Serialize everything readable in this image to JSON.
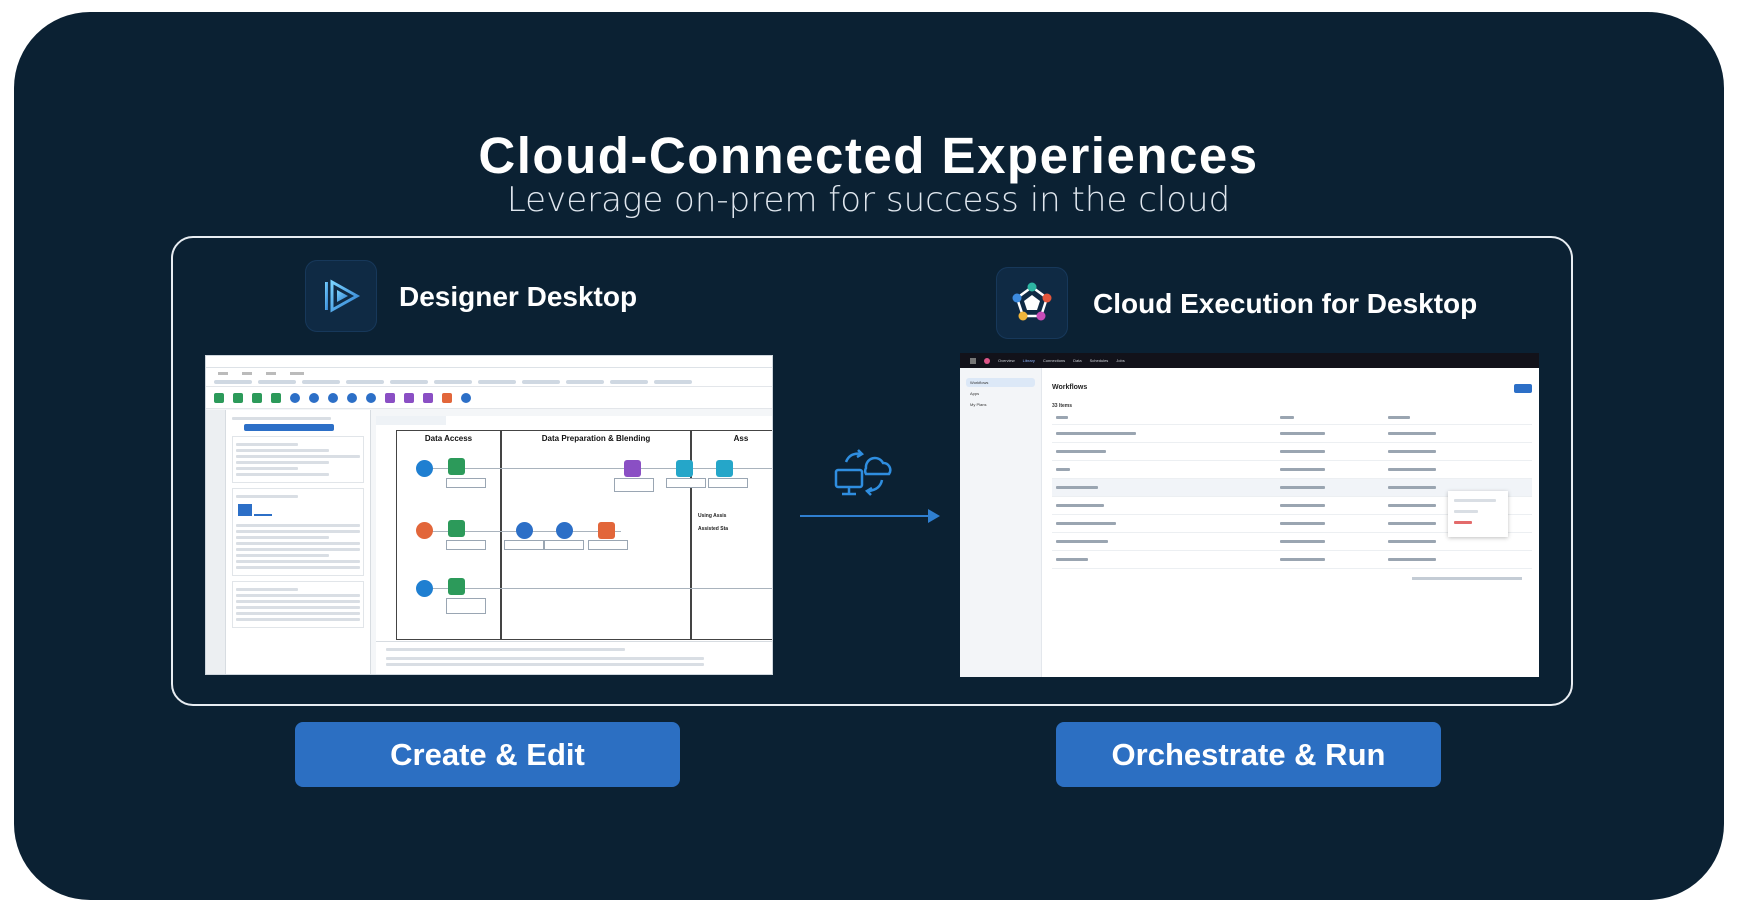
{
  "header": {
    "title": "Cloud-Connected Experiences",
    "subtitle": "Leverage on-prem for success in the cloud"
  },
  "left_panel": {
    "title": "Designer Desktop",
    "logo_icon": "designer-play-icon",
    "screenshot": {
      "containers": [
        "Data Access",
        "Data Preparation & Blending",
        "Ass"
      ],
      "canvas_labels": [
        "Using Assis",
        "Assisted Sta"
      ]
    },
    "button_label": "Create & Edit"
  },
  "right_panel": {
    "title": "Cloud Execution for Desktop",
    "logo_icon": "pentagon-nodes-icon",
    "screenshot": {
      "nav": [
        "Overview",
        "Library",
        "Connections",
        "Data",
        "Schedules",
        "Jobs"
      ],
      "sidebar": [
        "Workflows",
        "Apps",
        "My Plans"
      ],
      "heading": "Workflows",
      "count": "33 Items"
    },
    "button_label": "Orchestrate & Run"
  },
  "connector": {
    "icon": "cloud-desktop-sync-icon"
  },
  "colors": {
    "background": "#0b2133",
    "accent": "#2c6fc2",
    "arrow": "#2f7fd0"
  }
}
